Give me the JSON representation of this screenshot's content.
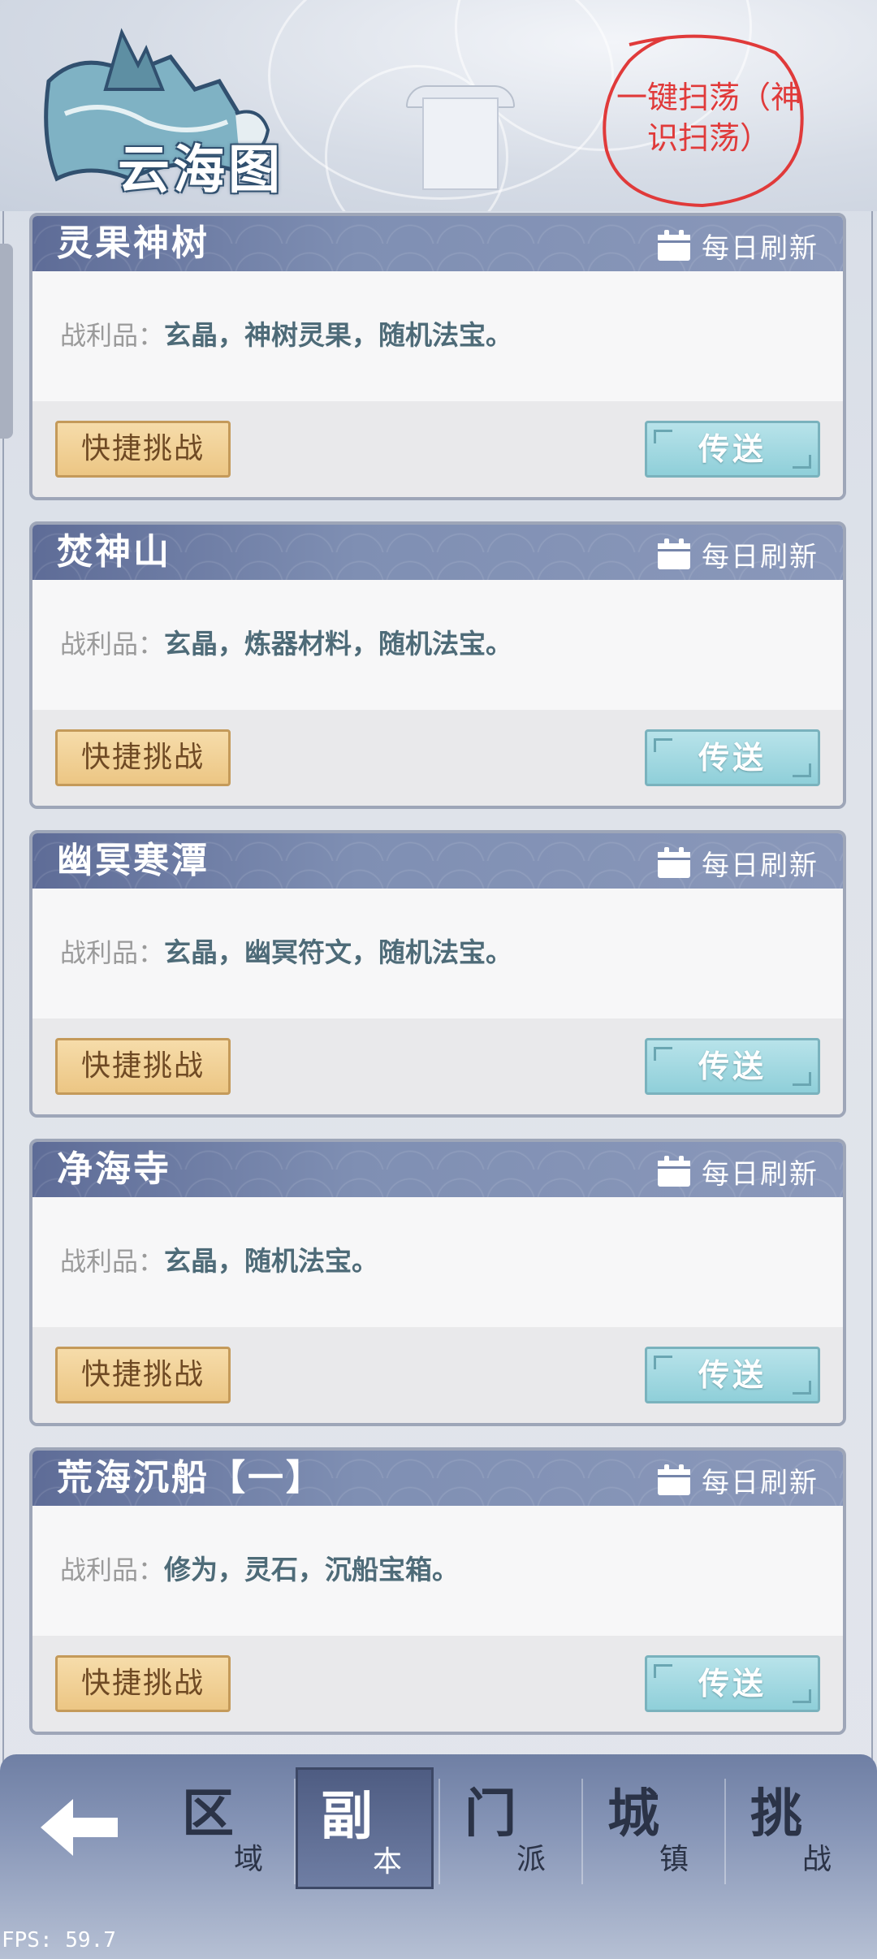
{
  "header": {
    "title": "云海图",
    "annotation": "一键扫荡（神识扫荡）",
    "annotation_color": "#e03a3a"
  },
  "cards": [
    {
      "title": "灵果神树",
      "refresh": "每日刷新",
      "loot_label": "战利品：",
      "loot": "玄晶，神树灵果，随机法宝。",
      "quick": "快捷挑战",
      "teleport": "传送"
    },
    {
      "title": "焚神山",
      "refresh": "每日刷新",
      "loot_label": "战利品：",
      "loot": "玄晶，炼器材料，随机法宝。",
      "quick": "快捷挑战",
      "teleport": "传送"
    },
    {
      "title": "幽冥寒潭",
      "refresh": "每日刷新",
      "loot_label": "战利品：",
      "loot": "玄晶，幽冥符文，随机法宝。",
      "quick": "快捷挑战",
      "teleport": "传送"
    },
    {
      "title": "净海寺",
      "refresh": "每日刷新",
      "loot_label": "战利品：",
      "loot": "玄晶，随机法宝。",
      "quick": "快捷挑战",
      "teleport": "传送"
    },
    {
      "title": "荒海沉船【一】",
      "refresh": "每日刷新",
      "loot_label": "战利品：",
      "loot": "修为，灵石，沉船宝箱。",
      "quick": "快捷挑战",
      "teleport": "传送"
    }
  ],
  "nav": {
    "tabs": [
      {
        "big": "区",
        "small": "域"
      },
      {
        "big": "副",
        "small": "本"
      },
      {
        "big": "门",
        "small": "派"
      },
      {
        "big": "城",
        "small": "镇"
      },
      {
        "big": "挑",
        "small": "战"
      }
    ],
    "active_tab": "副本",
    "back_icon": "arrow-left-icon"
  },
  "fps": "FPS: 59.7",
  "colors": {
    "card_header": "#6f7ea4",
    "quick_button": "#ecc684",
    "teleport_button": "#8fcfd9"
  }
}
